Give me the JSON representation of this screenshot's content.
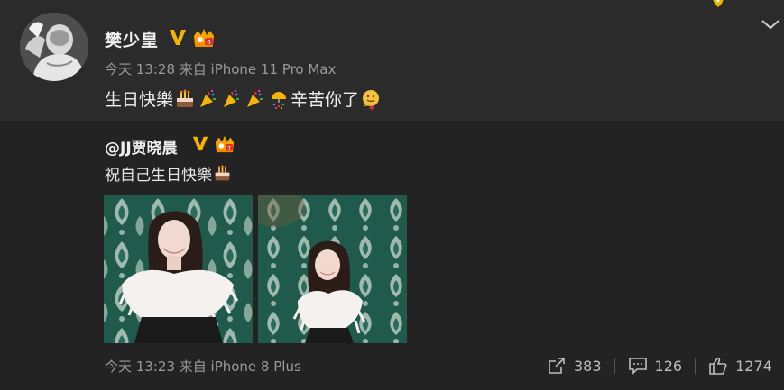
{
  "post": {
    "username": "樊少皇",
    "meta": "今天 13:28 来自 iPhone 11 Pro Max",
    "text_main": "生日快樂",
    "text_tail": "辛苦你了",
    "level_badge": "6"
  },
  "repost": {
    "username": "@JJ贾晓晨",
    "text": "祝自己生日快樂",
    "meta": "今天 13:23 来自 iPhone 8 Plus",
    "level_badge": "7"
  },
  "actions": {
    "share_count": "383",
    "comment_count": "126",
    "like_count": "1274"
  },
  "colors": {
    "background": "#2b2b2b",
    "repost_background": "#232323",
    "verified": "#f5b400",
    "meta_text": "#9a9a9a"
  },
  "icons": {
    "verified": "verified-v-icon",
    "level": "crown-level-icon",
    "cake": "cake-emoji-icon",
    "party": "party-popper-icon",
    "confetti": "confetti-ball-icon",
    "hug": "hug-face-icon",
    "share": "share-icon",
    "comment": "comment-icon",
    "like": "thumbs-up-icon",
    "menu": "chevron-down-icon"
  }
}
